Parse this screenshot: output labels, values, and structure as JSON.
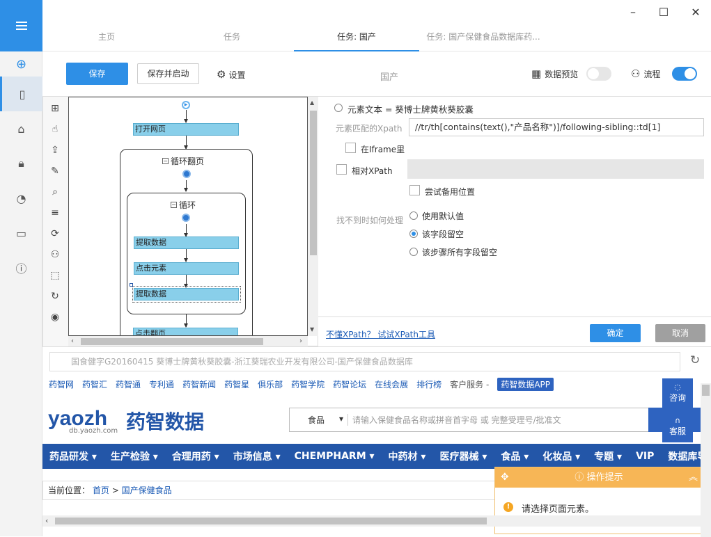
{
  "window": {
    "minimize": "–",
    "maximize": "☐",
    "close": "✕"
  },
  "tabs": [
    {
      "label": "主页"
    },
    {
      "label": "任务"
    },
    {
      "label": "任务: 国产"
    },
    {
      "label": "任务: 国产保健食品数据库药..."
    }
  ],
  "toolbar": {
    "save": "保存",
    "save_start": "保存并启动",
    "settings": "设置",
    "task_name": "国产",
    "preview": "数据预览",
    "flow": "流程",
    "preview_on": false,
    "flow_on": true
  },
  "flow": {
    "open_page": "打开网页",
    "loop_page": "循环翻页",
    "loop": "循环",
    "extract1": "提取数据",
    "click": "点击元素",
    "extract2": "提取数据",
    "click_next": "点击翻页"
  },
  "props": {
    "element_text": "元素文本 = 葵博士牌黄秋葵胶囊",
    "xpath_label": "元素匹配的Xpath",
    "xpath_value": "//tr/th[contains(text(),\"产品名称\")]/following-sibling::td[1]",
    "iframe": "在Iframe里",
    "relative_xpath": "相对XPath",
    "try_backup": "尝试备用位置",
    "not_found_label": "找不到时如何处理",
    "opt_default": "使用默认值",
    "opt_empty": "该字段留空",
    "opt_all_empty": "该步骤所有字段留空",
    "xpath_help": "不懂XPath？ 试试XPath工具",
    "ok": "确定",
    "cancel": "取消"
  },
  "browser": {
    "url": "国食健字G20160415 葵博士牌黄秋葵胶囊-浙江葵瑞农业开发有限公司-国产保健食品数据库",
    "top_links": [
      "药智网",
      "药智汇",
      "药智通",
      "专利通",
      "药智新闻",
      "药智星",
      "俱乐部",
      "药智学院",
      "药智论坛",
      "在线会展",
      "排行榜",
      "客户服务 -"
    ],
    "app_badge": "药智数据APP",
    "logo_text": "yaozh",
    "logo_cn": "药智数据",
    "logo_sub": "db.yaozh.com",
    "search_category": "食品",
    "search_placeholder": "请输入保健食品名称或拼音首字母  或  完整受理号/批准文",
    "nav": [
      "药品研发 ▾",
      "生产检验 ▾",
      "合理用药 ▾",
      "市场信息 ▾",
      "CHEMPHARM ▾",
      "中药材 ▾",
      "医疗器械 ▾",
      "食品 ▾",
      "化妆品 ▾",
      "专题 ▾",
      "VIP",
      "数据库导"
    ],
    "breadcrumb_prefix": "当前位置：",
    "breadcrumb_home": "首页",
    "breadcrumb_sep": ">",
    "breadcrumb_current": "国产保健食品",
    "consult": "咨询",
    "service": "客服",
    "hint_title": "操作提示",
    "hint_msg": "请选择页面元素。"
  }
}
